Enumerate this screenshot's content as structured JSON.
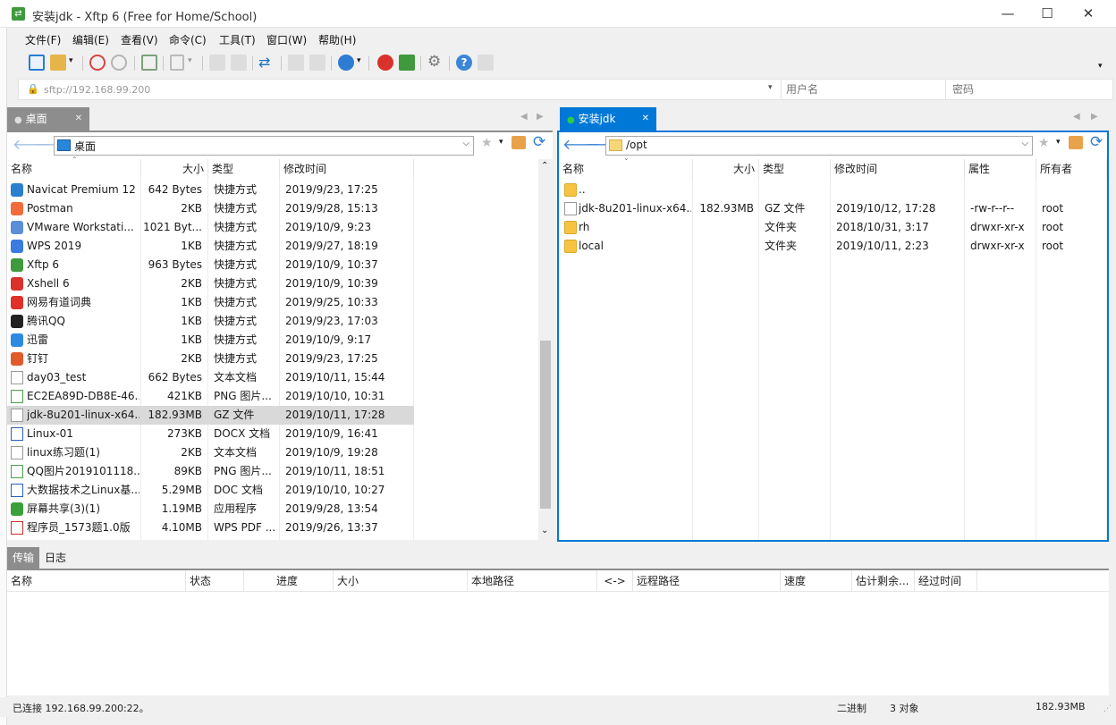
{
  "window": {
    "title": "安装jdk - Xftp 6 (Free for Home/School)",
    "minimize": "—",
    "maximize": "☐",
    "close": "✕"
  },
  "menu": [
    "文件(F)",
    "编辑(E)",
    "查看(V)",
    "命令(C)",
    "工具(T)",
    "窗口(W)",
    "帮助(H)"
  ],
  "address": {
    "url": "sftp://192.168.99.200",
    "username_placeholder": "用户名",
    "password_placeholder": "密码"
  },
  "left": {
    "tab_label": "桌面",
    "path": "桌面",
    "columns": [
      "名称",
      "大小",
      "类型",
      "修改时间"
    ],
    "files": [
      {
        "name": "Navicat Premium 12",
        "size": "642 Bytes",
        "type": "快捷方式",
        "modified": "2019/9/23, 17:25",
        "icon": "navicat-icon",
        "color": "#2a7fcf"
      },
      {
        "name": "Postman",
        "size": "2KB",
        "type": "快捷方式",
        "modified": "2019/9/28, 15:13",
        "icon": "postman-icon",
        "color": "#f26b3a"
      },
      {
        "name": "VMware Workstati...",
        "size": "1021 Byt...",
        "type": "快捷方式",
        "modified": "2019/10/9, 9:23",
        "icon": "vmware-icon",
        "color": "#5a8fd8"
      },
      {
        "name": "WPS 2019",
        "size": "1KB",
        "type": "快捷方式",
        "modified": "2019/9/27, 18:19",
        "icon": "wps-icon",
        "color": "#3a7be0"
      },
      {
        "name": "Xftp 6",
        "size": "963 Bytes",
        "type": "快捷方式",
        "modified": "2019/10/9, 10:37",
        "icon": "xftp-icon",
        "color": "#3f9a3d"
      },
      {
        "name": "Xshell 6",
        "size": "2KB",
        "type": "快捷方式",
        "modified": "2019/10/9, 10:39",
        "icon": "xshell-icon",
        "color": "#d9322b"
      },
      {
        "name": "网易有道词典",
        "size": "1KB",
        "type": "快捷方式",
        "modified": "2019/9/25, 10:33",
        "icon": "youdao-icon",
        "color": "#e0302a"
      },
      {
        "name": "腾讯QQ",
        "size": "1KB",
        "type": "快捷方式",
        "modified": "2019/9/23, 17:03",
        "icon": "qq-icon",
        "color": "#222222"
      },
      {
        "name": "迅雷",
        "size": "1KB",
        "type": "快捷方式",
        "modified": "2019/10/9, 9:17",
        "icon": "thunder-icon",
        "color": "#2d8ae0"
      },
      {
        "name": "钉钉",
        "size": "2KB",
        "type": "快捷方式",
        "modified": "2019/9/23, 17:25",
        "icon": "dingtalk-icon",
        "color": "#e05a2a"
      },
      {
        "name": "day03_test",
        "size": "662 Bytes",
        "type": "文本文档",
        "modified": "2019/10/11, 15:44",
        "icon": "text-file-icon",
        "color": "#9a9a9a"
      },
      {
        "name": "EC2EA89D-DB8E-46...",
        "size": "421KB",
        "type": "PNG 图片...",
        "modified": "2019/10/10, 10:31",
        "icon": "png-file-icon",
        "color": "#4aa04a"
      },
      {
        "name": "jdk-8u201-linux-x64...",
        "size": "182.93MB",
        "type": "GZ 文件",
        "modified": "2019/10/11, 17:28",
        "icon": "gz-file-icon",
        "color": "#9a9a9a"
      },
      {
        "name": "Linux-01",
        "size": "273KB",
        "type": "DOCX 文档",
        "modified": "2019/10/9, 16:41",
        "icon": "docx-file-icon",
        "color": "#2b5fc0"
      },
      {
        "name": "linux练习题(1)",
        "size": "2KB",
        "type": "文本文档",
        "modified": "2019/10/9, 19:28",
        "icon": "text-file-icon",
        "color": "#9a9a9a"
      },
      {
        "name": "QQ图片2019101118...",
        "size": "89KB",
        "type": "PNG 图片...",
        "modified": "2019/10/11, 18:51",
        "icon": "png-file-icon",
        "color": "#4aa04a"
      },
      {
        "name": "大数据技术之Linux基...",
        "size": "5.29MB",
        "type": "DOC 文档",
        "modified": "2019/10/10, 10:27",
        "icon": "doc-file-icon",
        "color": "#2b5fc0"
      },
      {
        "name": "屏幕共享(3)(1)",
        "size": "1.19MB",
        "type": "应用程序",
        "modified": "2019/9/28, 13:54",
        "icon": "app-icon",
        "color": "#3aa03a"
      },
      {
        "name": "程序员_1573题1.0版",
        "size": "4.10MB",
        "type": "WPS PDF ...",
        "modified": "2019/9/26, 13:37",
        "icon": "pdf-file-icon",
        "color": "#d0302a"
      }
    ],
    "selected_index": 12
  },
  "right": {
    "tab_label": "安装jdk",
    "path": "/opt",
    "columns": [
      "名称",
      "大小",
      "类型",
      "修改时间",
      "属性",
      "所有者"
    ],
    "files": [
      {
        "name": "..",
        "size": "",
        "type": "",
        "modified": "",
        "attr": "",
        "owner": "",
        "icon": "folder-icon"
      },
      {
        "name": "jdk-8u201-linux-x64...",
        "size": "182.93MB",
        "type": "GZ 文件",
        "modified": "2019/10/12, 17:28",
        "attr": "-rw-r--r--",
        "owner": "root",
        "icon": "gz-file-icon"
      },
      {
        "name": "rh",
        "size": "",
        "type": "文件夹",
        "modified": "2018/10/31, 3:17",
        "attr": "drwxr-xr-x",
        "owner": "root",
        "icon": "folder-icon"
      },
      {
        "name": "local",
        "size": "",
        "type": "文件夹",
        "modified": "2019/10/11, 2:23",
        "attr": "drwxr-xr-x",
        "owner": "root",
        "icon": "folder-icon"
      }
    ]
  },
  "transfer": {
    "tabs": [
      "传输",
      "日志"
    ],
    "columns": [
      "名称",
      "状态",
      "进度",
      "大小",
      "本地路径",
      "<->",
      "远程路径",
      "速度",
      "估计剩余...",
      "经过时间"
    ]
  },
  "status": {
    "connection": "已连接 192.168.99.200:22。",
    "mode": "二进制",
    "objects": "3 对象",
    "size": "182.93MB"
  },
  "colors": {
    "accent": "#0078d7",
    "selection": "#d9d9d9",
    "folder": "#f6c343"
  }
}
